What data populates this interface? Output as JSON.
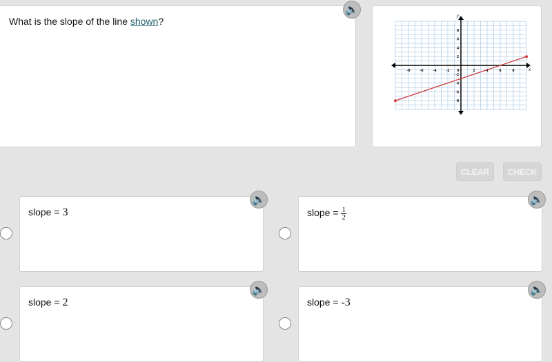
{
  "question": {
    "prefix": "What is the slope of the line ",
    "link": "shown",
    "suffix": "?"
  },
  "graph": {
    "x_range": [
      -10,
      10
    ],
    "y_range": [
      -10,
      10
    ],
    "grid_step": 1,
    "x_ticks": [
      "-8",
      "-6",
      "-4",
      "-2",
      "0",
      "2",
      "4",
      "6",
      "8"
    ],
    "y_ticks": [
      "8",
      "6",
      "4",
      "2",
      "-2",
      "-4",
      "-6",
      "-8"
    ],
    "x_label": "x",
    "y_label": "y",
    "line": {
      "from": [
        -10,
        -8
      ],
      "to": [
        10,
        2
      ]
    },
    "line_color": "#d23b3b",
    "grid_color": "#a9c8e6"
  },
  "buttons": {
    "clear": "CLEAR",
    "check": "CHECK"
  },
  "answers": [
    {
      "label": "slope = ",
      "value": "3"
    },
    {
      "label": "slope = ",
      "numerator": "1",
      "denominator": "2"
    },
    {
      "label": "slope = ",
      "value": "2"
    },
    {
      "label": "slope = ",
      "value": "-3"
    }
  ]
}
